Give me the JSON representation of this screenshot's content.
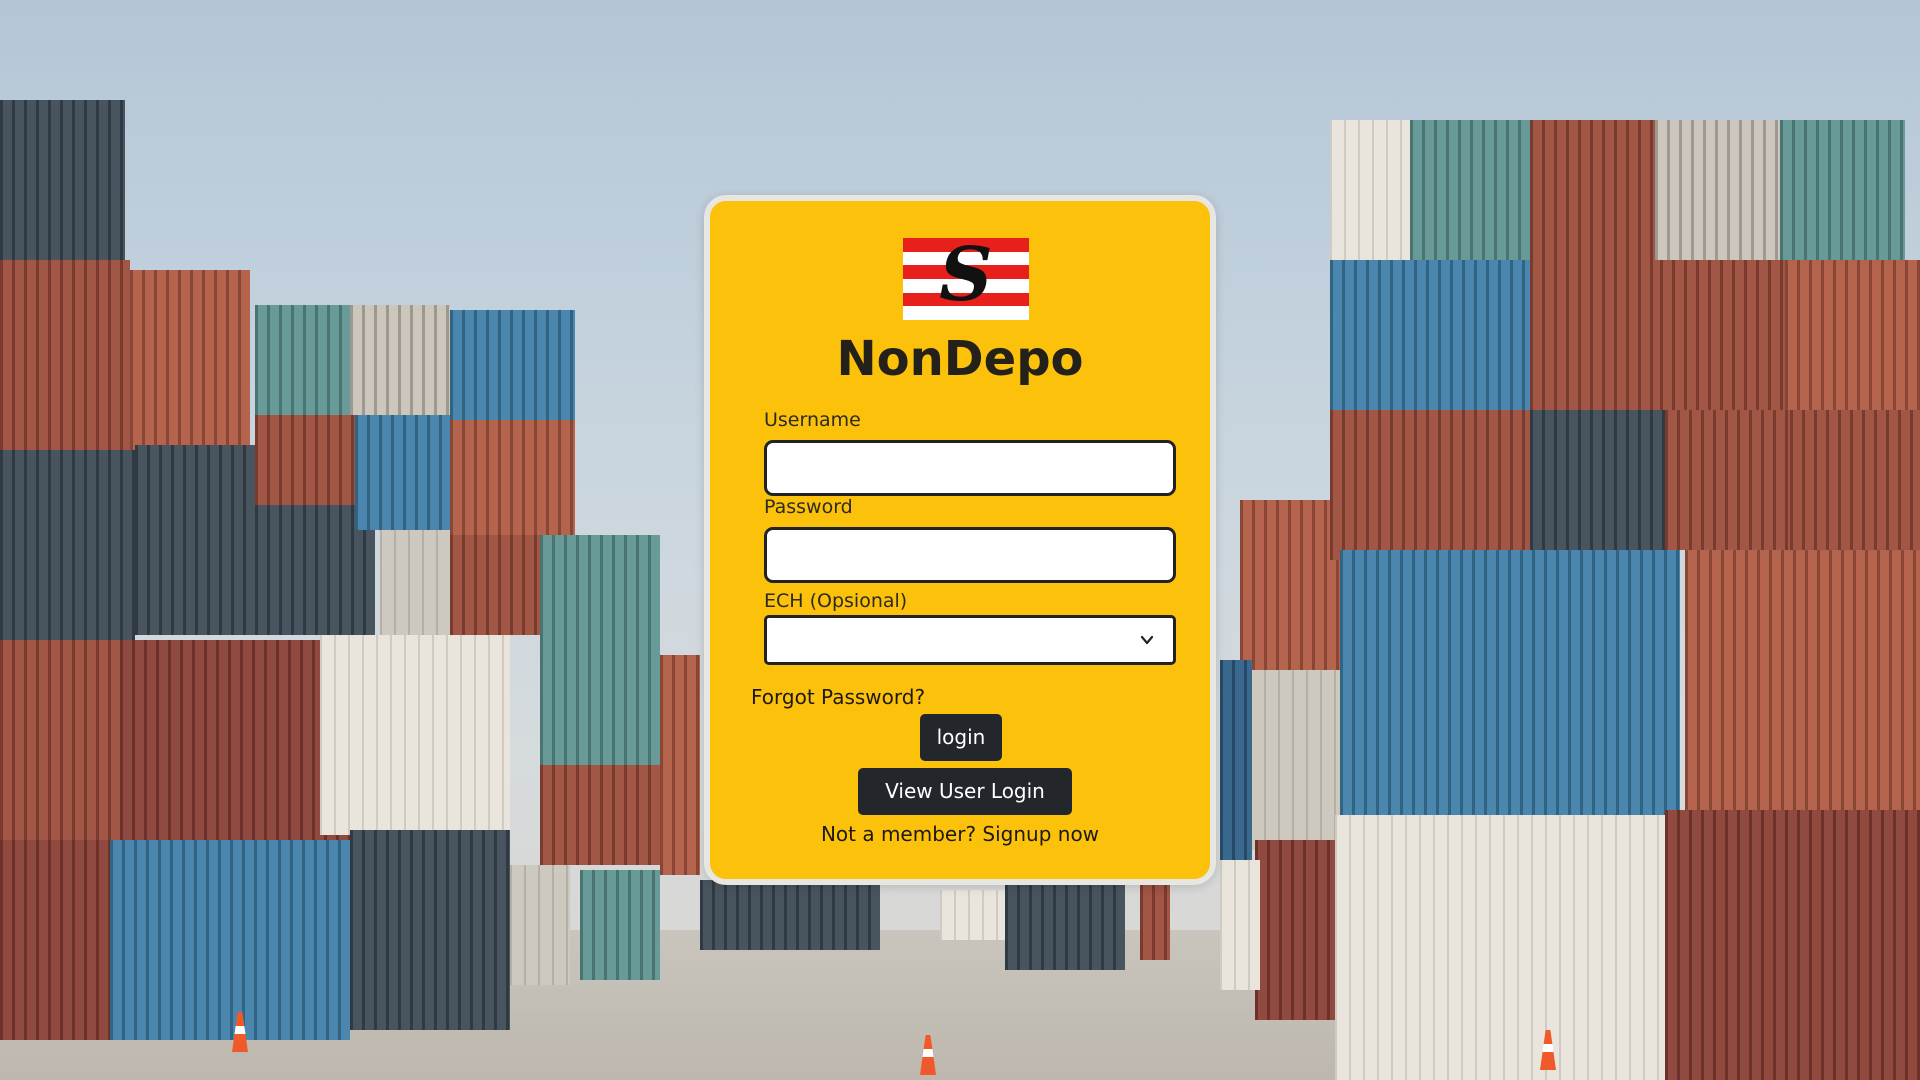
{
  "app": {
    "brand_name": "NonDepo",
    "logo_letter": "S"
  },
  "form": {
    "username_label": "Username",
    "username_value": "",
    "password_label": "Password",
    "password_value": "",
    "ech_label": "ECH (Opsional)",
    "ech_selected": ""
  },
  "links": {
    "forgot_password": "Forgot Password?",
    "not_member": "Not a member?",
    "signup": "Signup now"
  },
  "buttons": {
    "login": "login",
    "view_user_login": "View User Login"
  },
  "icons": {
    "select_arrow": "chevron-down-icon"
  },
  "colors": {
    "card": "#fcc10b",
    "button": "#23262b",
    "logo_red": "#e8201c"
  }
}
